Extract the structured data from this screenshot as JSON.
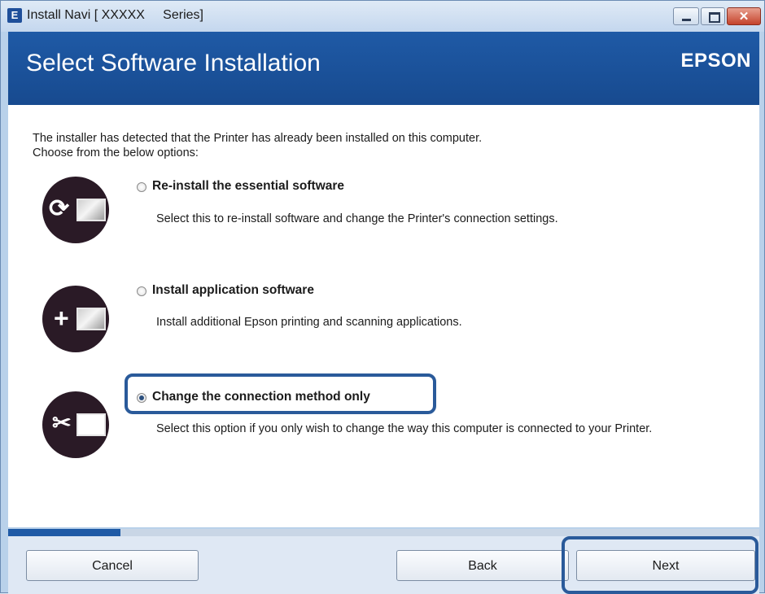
{
  "window": {
    "title": "Install Navi [ XXXXX     Series]",
    "app_icon": "E"
  },
  "header": {
    "title": "Select Software Installation",
    "brand": "EPSON"
  },
  "intro": {
    "line1": "The installer has detected that the Printer has already been installed on this computer.",
    "line2": "Choose from the below options:"
  },
  "options": [
    {
      "label": "Re-install the essential software",
      "description": "Select this to re-install software and change the Printer's connection settings.",
      "selected": false,
      "icon": "reinstall-printer-icon"
    },
    {
      "label": "Install application software",
      "description": "Install additional Epson printing and scanning applications.",
      "selected": false,
      "icon": "add-printer-icon"
    },
    {
      "label": "Change the connection method only",
      "description": "Select this option if you only wish to change the way this computer is connected to your Printer.",
      "selected": true,
      "icon": "tools-printer-icon"
    }
  ],
  "progress": {
    "fraction": 0.15
  },
  "footer": {
    "cancel": "Cancel",
    "back": "Back",
    "next": "Next"
  },
  "colors": {
    "header_bg": "#1f5aa6",
    "highlight": "#2a5a9a",
    "icon_circle": "#2a1a26"
  }
}
